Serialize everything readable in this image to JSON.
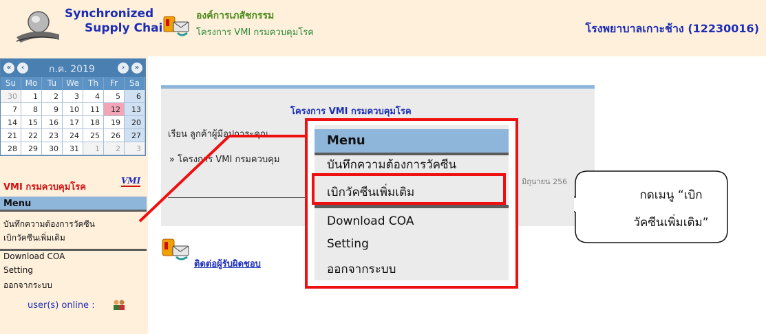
{
  "header": {
    "brand_line1": "Synchronized",
    "brand_line2": "Supply Chain",
    "org_name": "องค์การเภสัชกรรม",
    "org_project": "โครงการ VMI กรมควบคุมโรค",
    "hospital": "โรงพยาบาลเกาะช้าง (12230016)"
  },
  "calendar": {
    "month_label": "ก.ค. 2019",
    "days_of_week": [
      "Su",
      "Mo",
      "Tu",
      "We",
      "Th",
      "Fr",
      "Sa"
    ],
    "weeks": [
      [
        "30",
        "1",
        "2",
        "3",
        "4",
        "5",
        "6"
      ],
      [
        "7",
        "8",
        "9",
        "10",
        "11",
        "12",
        "13"
      ],
      [
        "14",
        "15",
        "16",
        "17",
        "18",
        "19",
        "20"
      ],
      [
        "21",
        "22",
        "23",
        "24",
        "25",
        "26",
        "27"
      ],
      [
        "28",
        "29",
        "30",
        "31",
        "1",
        "2",
        "3"
      ]
    ],
    "today": "12"
  },
  "sidebar": {
    "vmi_label": "VMI กรมควบคุมโรค",
    "vmi_logo": "VMI",
    "menu_title": "Menu",
    "items": [
      "บันทึกความต้องการวัคซีน",
      "เบิกวัคซีนเพิ่มเติม",
      "Download COA",
      "Setting",
      "ออกจากระบบ"
    ],
    "online_label": "user(s) online :"
  },
  "panel": {
    "title": "โครงการ VMI กรมควบคุมโรค",
    "greeting": "เรียน ลูกค้าผู้มีอุปการะคุณ",
    "link": "» โครงการ VMI กรมควบคุม",
    "date_fragment": "มิถุนายน 256"
  },
  "contact": {
    "label": "ติดต่อผู้รับผิดชอบ"
  },
  "zoom_menu": {
    "title": "Menu",
    "items": [
      "บันทึกความต้องการวัคซีน",
      "เบิกวัคซีนเพิ่มเติม",
      "Download COA",
      "Setting",
      "ออกจากระบบ"
    ]
  },
  "callout": {
    "line1": "กดเมนู “เบิก",
    "line2": "วัคซีนเพิ่มเติม”"
  },
  "colors": {
    "header_bg": "#fff0dc",
    "brand_blue": "#1b2db5",
    "menu_blue": "#8eb6db",
    "highlight_red": "#ee1010"
  }
}
